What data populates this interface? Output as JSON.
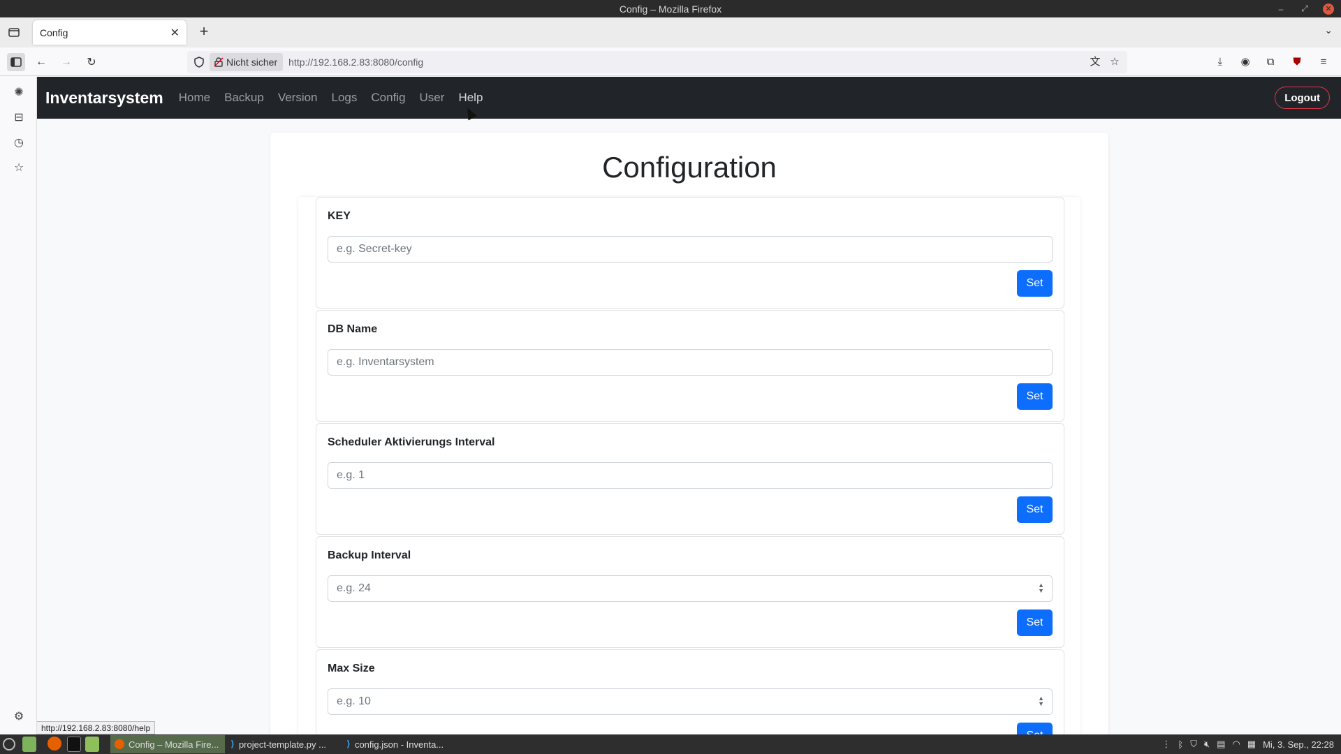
{
  "window": {
    "title": "Config – Mozilla Firefox"
  },
  "browser": {
    "tab_title": "Config",
    "security_label": "Nicht sicher",
    "url_scheme": "http://",
    "url_host": "192.168.2.83",
    "url_path": ":8080/config",
    "status_link": "http://192.168.2.83:8080/help"
  },
  "app": {
    "brand": "Inventarsystem",
    "nav": [
      "Home",
      "Backup",
      "Version",
      "Logs",
      "Config",
      "User",
      "Help"
    ],
    "logout": "Logout"
  },
  "config": {
    "title": "Configuration",
    "fields": [
      {
        "label": "KEY",
        "placeholder": "e.g. Secret-key",
        "button": "Set"
      },
      {
        "label": "DB Name",
        "placeholder": "e.g. Inventarsystem",
        "button": "Set"
      },
      {
        "label": "Scheduler Aktivierungs Interval",
        "placeholder": "e.g. 1",
        "button": "Set"
      },
      {
        "label": "Backup Interval",
        "placeholder": "e.g. 24",
        "button": "Set"
      },
      {
        "label": "Max Size",
        "placeholder": "e.g. 10",
        "button": "Set"
      }
    ]
  },
  "taskbar": {
    "windows": [
      "Config – Mozilla Fire...",
      "project-template.py ...",
      "config.json - Inventa..."
    ],
    "clock": "Mi, 3. Sep., 22:28"
  },
  "colors": {
    "navbar": "#212529",
    "primary": "#0d6efd",
    "danger": "#dc3545"
  }
}
